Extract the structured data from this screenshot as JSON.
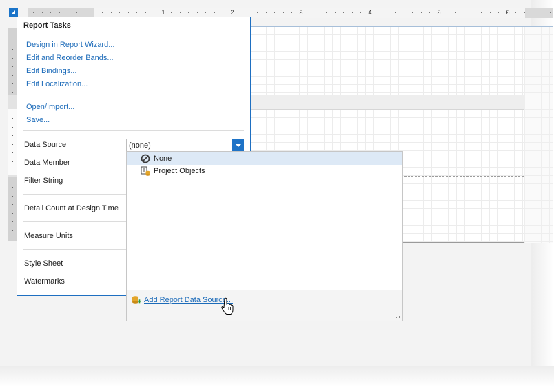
{
  "ruler": {
    "labels": [
      "1",
      "2",
      "3",
      "4",
      "5",
      "6"
    ]
  },
  "panel": {
    "title": "Report Tasks",
    "links_group1": [
      "Design in Report Wizard...",
      "Edit and Reorder Bands...",
      "Edit Bindings...",
      "Edit Localization..."
    ],
    "links_group2": [
      "Open/Import...",
      "Save..."
    ],
    "properties": {
      "data_source": "Data Source",
      "data_member": "Data Member",
      "filter_string": "Filter String",
      "detail_count": "Detail Count at Design Time",
      "measure_units": "Measure Units",
      "style_sheet": "Style Sheet",
      "watermarks": "Watermarks"
    },
    "data_source_value": "(none)"
  },
  "dropdown": {
    "items": [
      {
        "label": "None",
        "icon": "none-circle-icon",
        "selected": true
      },
      {
        "label": "Project Objects",
        "icon": "project-objects-icon",
        "selected": false
      }
    ],
    "footer_link": "Add Report Data Source..."
  },
  "colors": {
    "accent": "#1e73c7",
    "link": "#1c6bb9",
    "selection": "#dde9f6"
  }
}
